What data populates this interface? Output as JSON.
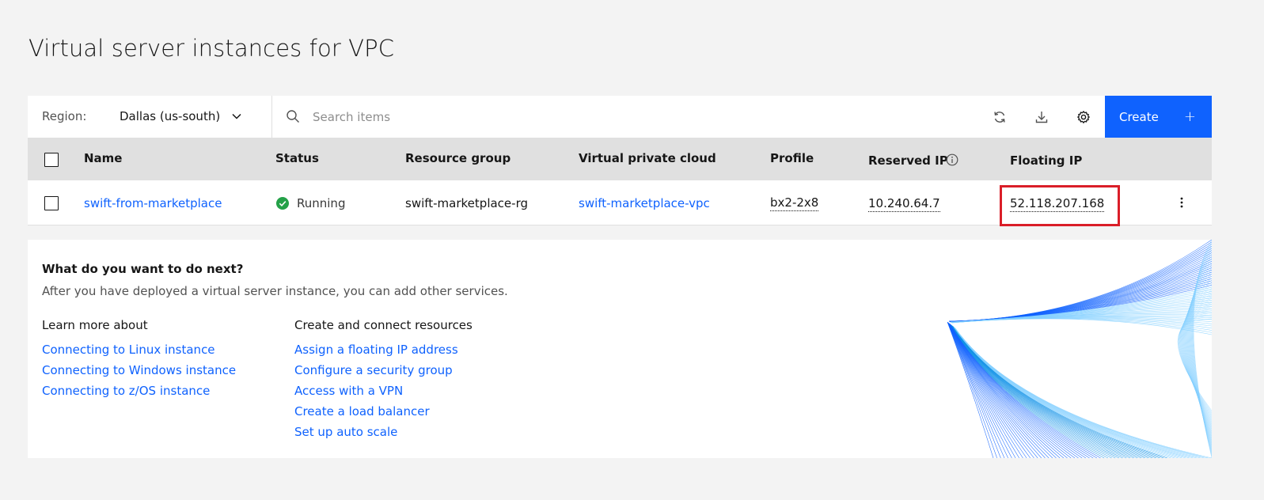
{
  "page": {
    "title": "Virtual server instances for VPC"
  },
  "toolbar": {
    "region_label": "Region:",
    "region_value": "Dallas (us-south)",
    "search_placeholder": "Search items",
    "create_label": "Create",
    "create_icon": "+"
  },
  "icons": {
    "region": "chevron-down-icon",
    "search": "search-icon",
    "refresh": "refresh-icon",
    "download": "download-icon",
    "settings": "gear-icon",
    "info": "info-icon",
    "status": "checkmark-circle-icon",
    "overflow": "overflow-menu-vertical-icon"
  },
  "table": {
    "columns": {
      "name": "Name",
      "status": "Status",
      "resource_group": "Resource group",
      "vpc": "Virtual private cloud",
      "profile": "Profile",
      "reserved_ip": "Reserved IP",
      "floating_ip": "Floating IP"
    },
    "rows": [
      {
        "name": "swift-from-marketplace",
        "status": "Running",
        "resource_group": "swift-marketplace-rg",
        "vpc": "swift-marketplace-vpc",
        "profile": "bx2-2x8",
        "reserved_ip": "10.240.64.7",
        "floating_ip": "52.118.207.168"
      }
    ]
  },
  "next_steps": {
    "title": "What do you want to do next?",
    "description": "After you have deployed a virtual server instance, you can add other services.",
    "learn": {
      "heading": "Learn more about",
      "links": [
        "Connecting to Linux instance",
        "Connecting to Windows instance",
        "Connecting to z/OS instance"
      ]
    },
    "create": {
      "heading": "Create and connect resources",
      "links": [
        "Assign a floating IP address",
        "Configure a security group",
        "Access with a VPN",
        "Create a load balancer",
        "Set up auto scale"
      ]
    }
  },
  "colors": {
    "accent": "#0f62fe",
    "status_ok": "#24a148",
    "highlight": "#da1e28",
    "header_bg": "#e0e0e0",
    "page_bg": "#f3f3f3"
  }
}
